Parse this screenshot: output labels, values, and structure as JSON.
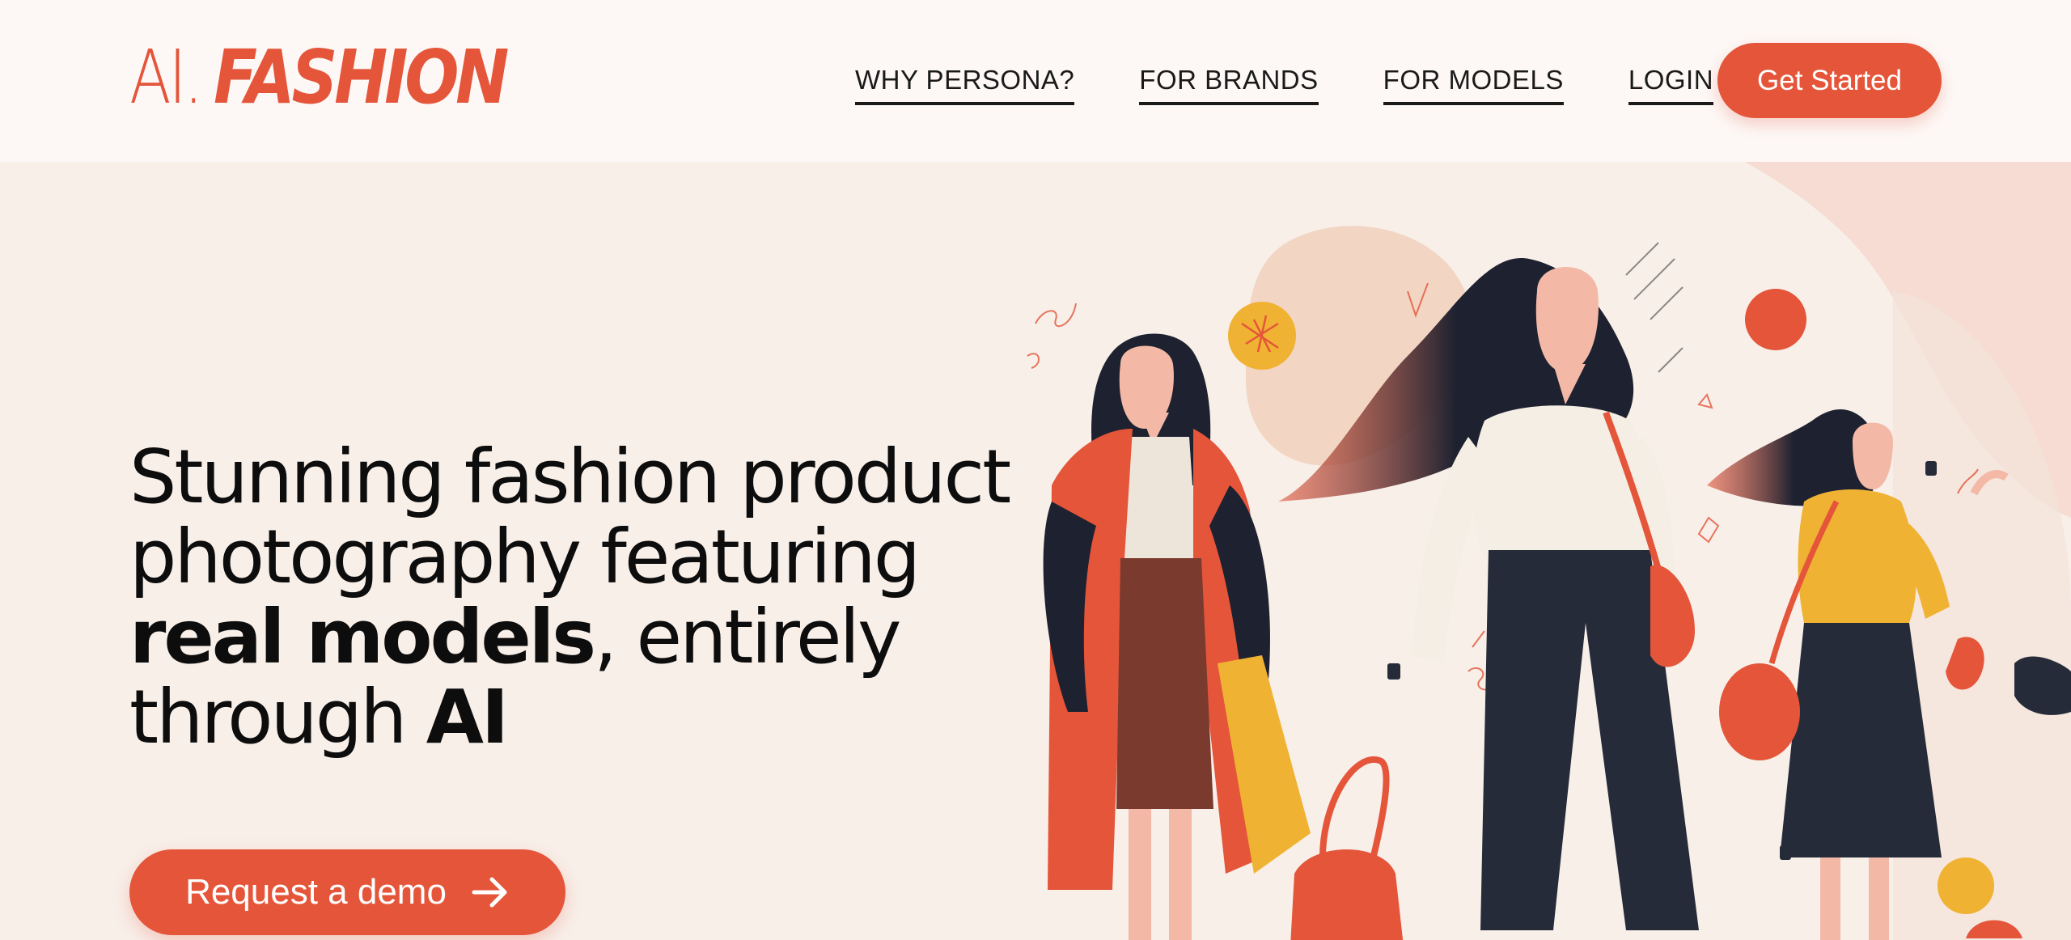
{
  "header": {
    "logo_prefix": "AI.",
    "logo_main": "FASHION",
    "nav": [
      {
        "label": "WHY PERSONA?"
      },
      {
        "label": "FOR BRANDS"
      },
      {
        "label": "FOR MODELS"
      },
      {
        "label": "LOGIN"
      }
    ],
    "cta_label": "Get Started"
  },
  "hero": {
    "line1": "Stunning fashion product",
    "line2": "photography featuring",
    "line3_bold": "real models",
    "line3_rest": ", entirely",
    "line4_text": "through ",
    "line4_bold": "AI",
    "button_label": "Request a demo",
    "button_icon": "arrow-right-icon"
  },
  "colors": {
    "accent": "#e4553a",
    "background": "#f8efe9",
    "header_bg": "#fdf8f6",
    "text": "#0d0d0d",
    "navy": "#252b38",
    "mustard": "#f0b232"
  }
}
